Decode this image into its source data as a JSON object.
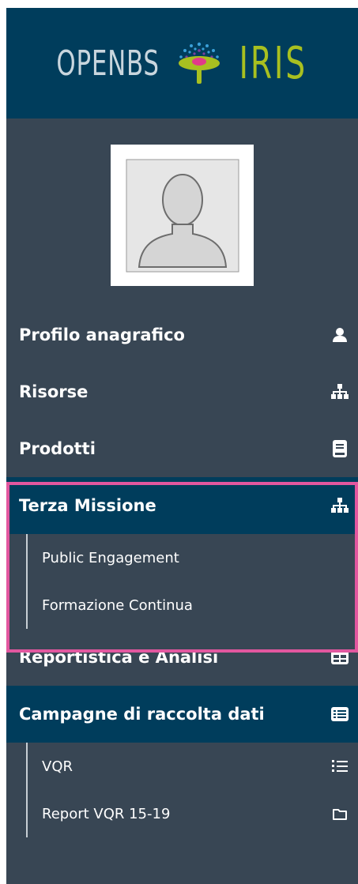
{
  "brand": {
    "left_text": "OPENBS",
    "right_text": "IRIS"
  },
  "avatar": {
    "icon": "user-placeholder-icon"
  },
  "menu": {
    "profilo": {
      "label": "Profilo anagrafico",
      "icon": "user-icon"
    },
    "risorse": {
      "label": "Risorse",
      "icon": "sitemap-icon"
    },
    "prodotti": {
      "label": "Prodotti",
      "icon": "book-icon"
    },
    "terza": {
      "label": "Terza Missione",
      "icon": "sitemap-icon",
      "items": [
        {
          "label": "Public Engagement"
        },
        {
          "label": "Formazione Continua"
        }
      ]
    },
    "reportistica": {
      "label": "Reportistica e Analisi",
      "icon": "table-icon"
    },
    "campagne": {
      "label": "Campagne di raccolta dati",
      "icon": "list-alt-icon",
      "items": [
        {
          "label": "VQR",
          "icon": "ordered-list-icon"
        },
        {
          "label": "Report VQR 15-19",
          "icon": "folder-icon"
        }
      ]
    }
  },
  "colors": {
    "sidebar_bg": "#384654",
    "active_bg": "#003d5c",
    "highlight_border": "#e2579f",
    "iris_green": "#a8c020"
  }
}
